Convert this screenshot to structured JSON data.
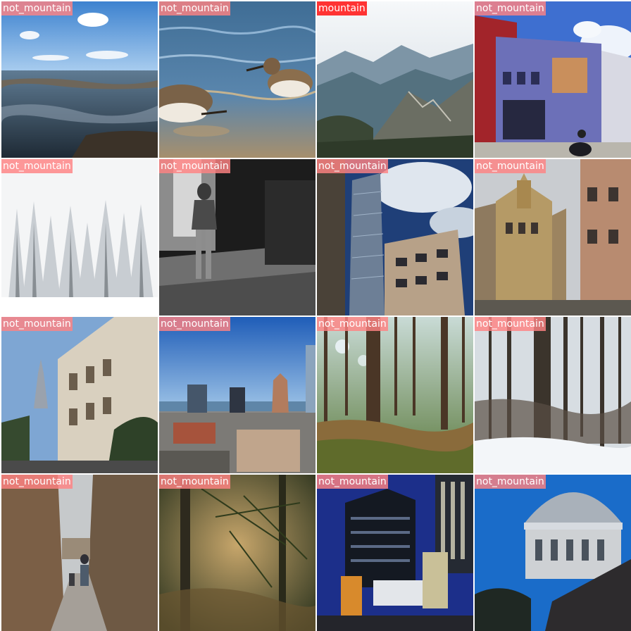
{
  "colors": {
    "positive_label_bg": "#ff2828",
    "negative_label_bg": "#ff8282",
    "label_text": "#ffffff"
  },
  "tiles": [
    {
      "label": "not_mountain",
      "scene": "tidal-flat-shore-sky"
    },
    {
      "label": "not_mountain",
      "scene": "sandpipers-in-water"
    },
    {
      "label": "mountain",
      "scene": "misty-mountain-valley"
    },
    {
      "label": "not_mountain",
      "scene": "street-corner-buildings"
    },
    {
      "label": "not_mountain",
      "scene": "snowy-pine-forest"
    },
    {
      "label": "not_mountain",
      "scene": "bw-person-in-hallway"
    },
    {
      "label": "not_mountain",
      "scene": "skyscraper-low-angle"
    },
    {
      "label": "not_mountain",
      "scene": "baroque-church-street"
    },
    {
      "label": "not_mountain",
      "scene": "ornate-building-tower"
    },
    {
      "label": "not_mountain",
      "scene": "city-skyline-aerial"
    },
    {
      "label": "not_mountain",
      "scene": "sunlit-pine-forest"
    },
    {
      "label": "not_mountain",
      "scene": "winter-bare-forest"
    },
    {
      "label": "not_mountain",
      "scene": "narrow-stone-alley"
    },
    {
      "label": "not_mountain",
      "scene": "blurred-pine-branches"
    },
    {
      "label": "not_mountain",
      "scene": "office-tower-dusk"
    },
    {
      "label": "not_mountain",
      "scene": "silver-dome-building"
    }
  ]
}
